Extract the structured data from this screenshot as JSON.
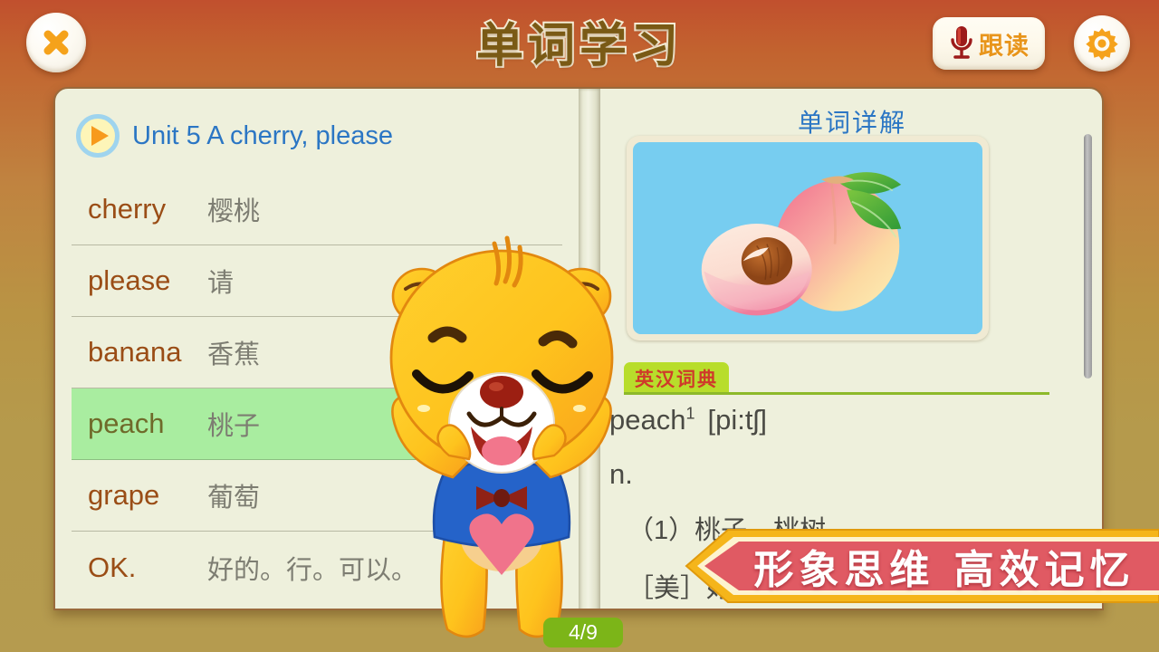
{
  "header": {
    "title": "单词学习",
    "close_icon": "close-x-icon",
    "follow_read": {
      "label": "跟读",
      "icon": "microphone-icon"
    },
    "settings_icon": "gear-icon"
  },
  "left_page": {
    "play_icon": "play-triangle-icon",
    "unit_title": "Unit 5 A cherry, please",
    "words": [
      {
        "en": "cherry",
        "cn": "樱桃",
        "selected": false
      },
      {
        "en": "please",
        "cn": "请",
        "selected": false
      },
      {
        "en": "banana",
        "cn": "香蕉",
        "selected": false
      },
      {
        "en": "peach",
        "cn": "桃子",
        "selected": true
      },
      {
        "en": "grape",
        "cn": "葡萄",
        "selected": false
      },
      {
        "en": "OK.",
        "cn": "好的。行。可以。",
        "selected": false
      }
    ]
  },
  "right_page": {
    "detail_title": "单词详解",
    "image_alt": "peach-illustration",
    "dictionary": {
      "tag": "英汉词典",
      "headword": "peach",
      "superscript": "1",
      "pronunciation": "[pi:tʃ]",
      "part_of_speech": "n.",
      "definitions": [
        "（1）桃子。桃树",
        "［美］好人。受欢迎的人",
        "。"
      ]
    }
  },
  "promo_banner": {
    "text": "形象思维 高效记忆"
  },
  "page_indicator": {
    "text": "4/9"
  },
  "mascot": {
    "name": "bear-mascot"
  },
  "colors": {
    "accent_blue": "#2b76c4",
    "selected_green": "#a9eda0",
    "tag_green": "#b8dd2b",
    "banner_red": "#e05a63",
    "banner_gold": "#f5b51a",
    "page_badge_green": "#7cb518",
    "word_en": "#9a4d16",
    "paper": "#eef0dc"
  }
}
